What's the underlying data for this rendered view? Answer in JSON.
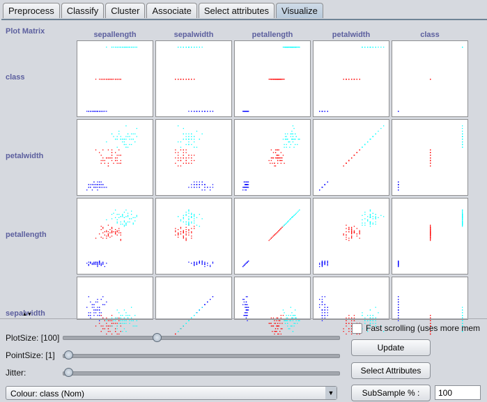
{
  "tabs": [
    {
      "label": "Preprocess"
    },
    {
      "label": "Classify"
    },
    {
      "label": "Cluster"
    },
    {
      "label": "Associate"
    },
    {
      "label": "Select attributes"
    },
    {
      "label": "Visualize",
      "active": true
    }
  ],
  "matrix": {
    "title": "Plot Matrix",
    "columns": [
      "sepallength",
      "sepalwidth",
      "petallength",
      "petalwidth",
      "class"
    ],
    "rows": [
      "class",
      "petalwidth",
      "petallength",
      "sepalwidth"
    ],
    "class_colors": {
      "Iris-setosa": "#0000ff",
      "Iris-versicolor": "#ff0000",
      "Iris-virginica": "#00ffff"
    }
  },
  "controls": {
    "plot_size_label": "PlotSize: [100]",
    "plot_size": 100,
    "point_size_label": "PointSize: [1]",
    "point_size": 1,
    "jitter_label": "Jitter:",
    "jitter": 0,
    "colour": "Colour: class  (Nom)",
    "fast_scrolling": "Fast scrolling (uses more mem",
    "fast_scrolling_checked": false,
    "update": "Update",
    "select_attributes": "Select Attributes",
    "subsample_label": "SubSample % :",
    "subsample": "100"
  }
}
